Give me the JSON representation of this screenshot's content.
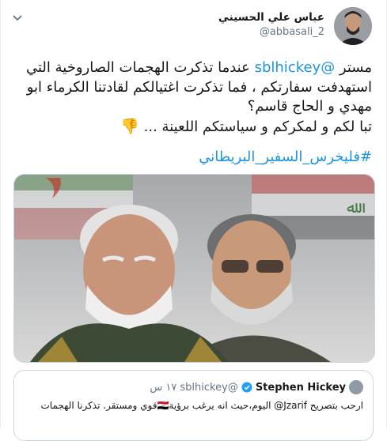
{
  "author": {
    "name": "عباس علي الحسيني",
    "handle": "@abbasali_2"
  },
  "tweet": {
    "prefix": "مستر ",
    "mention": "@sblhickey",
    "line1_rest": " عندما تذكرت الهجمات الصاروخية التي",
    "line2": "استهدفت سفارتكم ، فما تذكرت اغتيالكم لقادتنا الكرماء ابو",
    "line3": "مهدي و الحاج قاسم؟",
    "line4": "تبا لكم و لمكركم و سياستكم اللعينة ...",
    "emoji": "👎",
    "hashtag": "#فليخرس_السفير_البريطاني"
  },
  "quote": {
    "name": "Stephen Hickey",
    "handle": "@sblhickey",
    "time": "١٧ س",
    "text": "ارحب بتصريح Jzarif@ اليوم،حيث انه يرغب برؤية🇮🇶قوي ومستقر. تذكرنا الهجمات"
  },
  "colors": {
    "link": "#1b95e0",
    "secondary": "#657786",
    "border": "#ccd6dd"
  }
}
